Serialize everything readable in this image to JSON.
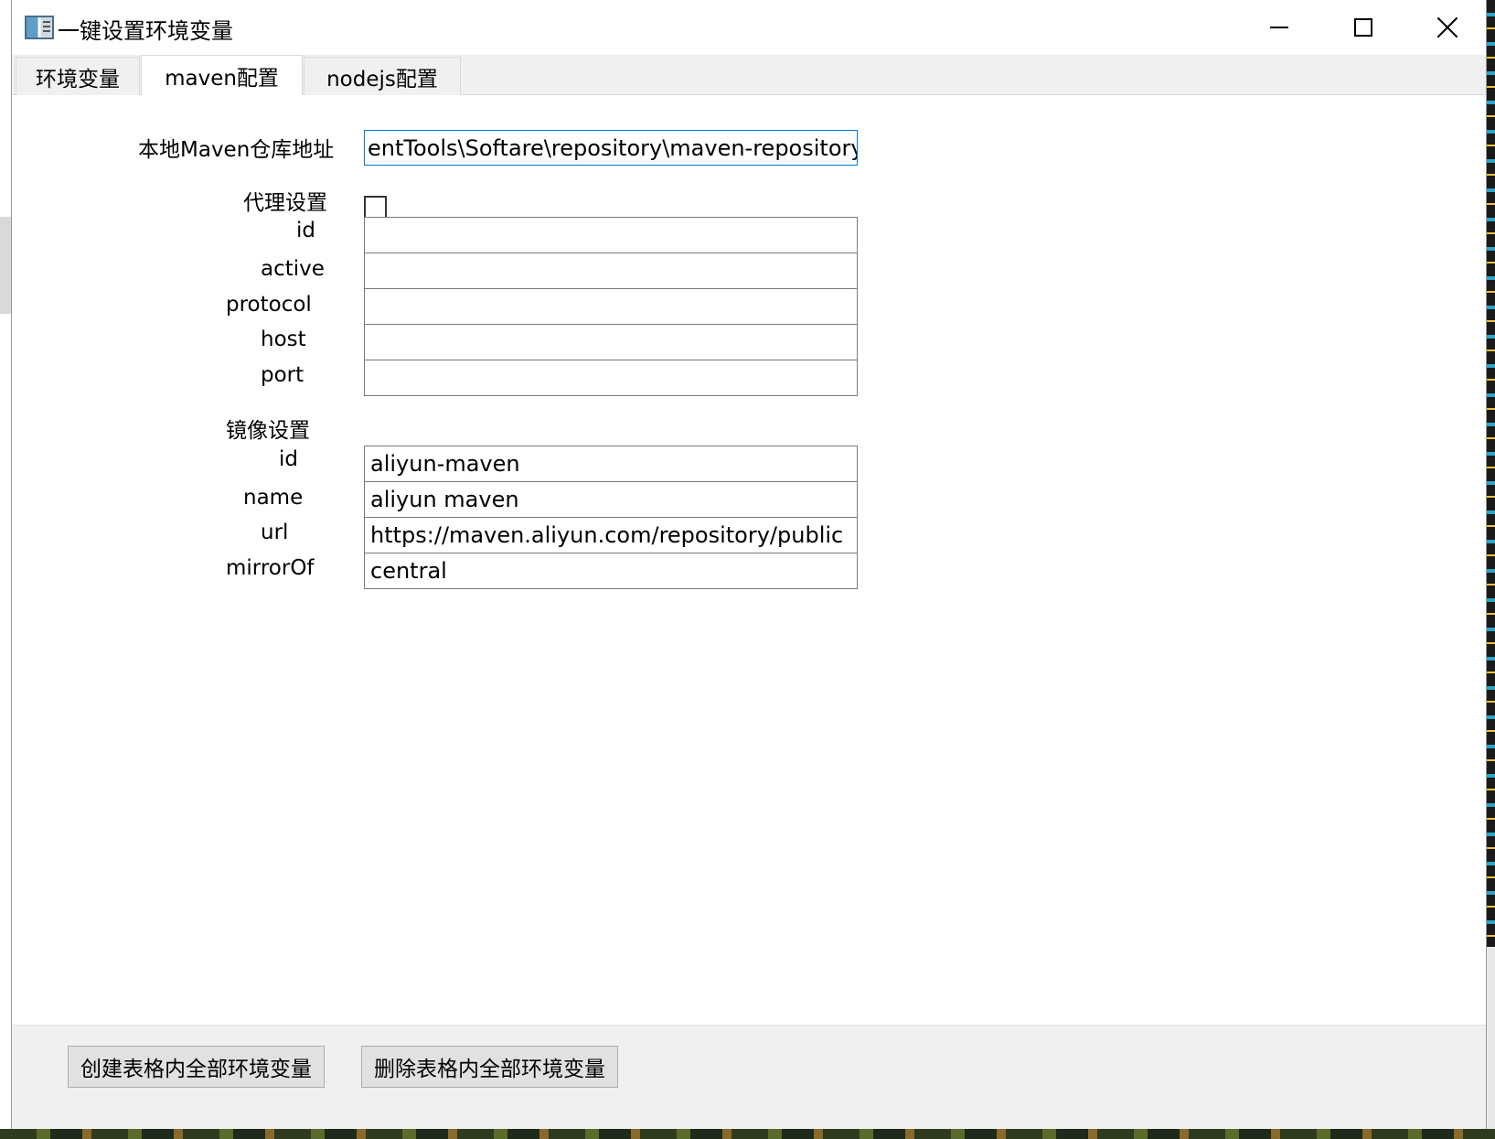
{
  "window": {
    "title": "一键设置环境变量"
  },
  "tabs": [
    {
      "label": "环境变量"
    },
    {
      "label": "maven配置"
    },
    {
      "label": "nodejs配置"
    }
  ],
  "maven": {
    "repo_label": "本地Maven仓库地址",
    "repo_value": "entTools\\Softare\\repository\\maven-repository",
    "proxy": {
      "label": "代理设置",
      "enabled": false,
      "id_label": "id",
      "id_value": "",
      "active_label": "active",
      "active_value": "",
      "protocol_label": "protocol",
      "protocol_value": "",
      "host_label": "host",
      "host_value": "",
      "port_label": "port",
      "port_value": ""
    },
    "mirror": {
      "label": "镜像设置",
      "id_label": "id",
      "id_value": "aliyun-maven",
      "name_label": "name",
      "name_value": "aliyun maven",
      "url_label": "url",
      "url_value": "https://maven.aliyun.com/repository/public",
      "mirrorof_label": "mirrorOf",
      "mirrorof_value": "central"
    }
  },
  "footer": {
    "create_label": "创建表格内全部环境变量",
    "delete_label": "删除表格内全部环境变量"
  }
}
